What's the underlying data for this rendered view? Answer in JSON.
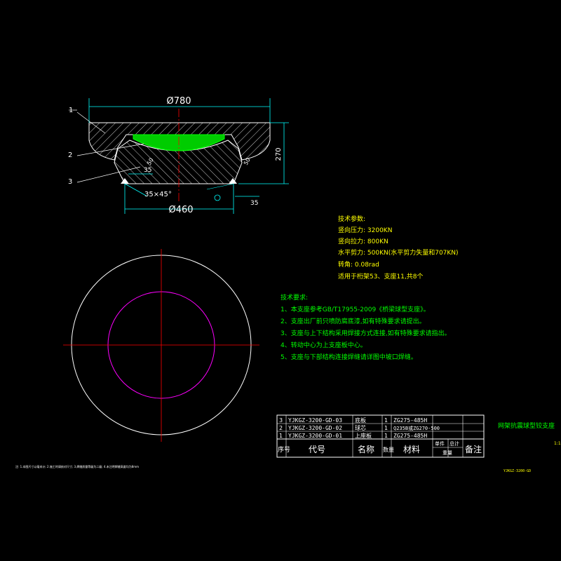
{
  "colors": {
    "background": "#000000",
    "line": "#ffffff",
    "dimension": "#00ffff",
    "center": "#ff0000",
    "green_part": "#00cc00",
    "text_yellow": "#ffff00",
    "text_green": "#00ff00",
    "circle_magenta": "#ff00ff"
  },
  "section": {
    "dim_top": "Ø780",
    "dim_bottom": "Ø460",
    "dim_height": "270",
    "dim_35_a": "35",
    "dim_35_b": "35",
    "dim_50_a": "50",
    "dim_50_b": "50",
    "chamfer": "35×45°",
    "callouts": [
      "1",
      "2",
      "3"
    ]
  },
  "params": {
    "title": "技术参数:",
    "lines": [
      "竖向压力: 3200KN",
      "竖向拉力: 800KN",
      "水平剪力: 500KN(水平剪力失量和707KN)",
      "转角: 0.08rad",
      "适用于桁架53、支座11,共8个"
    ]
  },
  "requirements": {
    "title": "技术要求:",
    "lines": [
      "1、本支座参考GB/T17955-2009《桥梁球型支座》。",
      "2、支座出厂前只喷防腐底漆,如有特殊要求请提出。",
      "3、支座与上下结构采用焊接方式连接,如有特殊要求请指出。",
      "4、转动中心为上支座板中心。",
      "5、支座与下部结构连接焊缝请详图中坡口焊缝。"
    ]
  },
  "bom": {
    "rows": [
      {
        "no": "3",
        "code": "YJKGZ-3200-GD-03",
        "name": "底板",
        "qty": "1",
        "material": "ZG275-485H"
      },
      {
        "no": "2",
        "code": "YJKGZ-3200-GD-02",
        "name": "球芯",
        "qty": "1",
        "material": "Q235B或ZG270-500"
      },
      {
        "no": "1",
        "code": "YJKGZ-3200-GD-01",
        "name": "上座板",
        "qty": "1",
        "material": "ZG275-485H"
      }
    ],
    "header": {
      "no": "序号",
      "code": "代号",
      "name": "名称",
      "qty": "数量",
      "material": "材料",
      "unit_w": "单件",
      "total_w": "总计",
      "weight": "重量",
      "remark": "备注"
    }
  },
  "title_block": {
    "title": "网架抗震球型铰支座",
    "sub": "1:1",
    "drawing_no": "YJKGZ-3200-GD"
  },
  "footer_note": "注: 1.本图尺寸以毫米计; 2.施工时请核对尺寸; 3.焊缝质量等级为二级; 4.未注明焊缝高度均为8mm"
}
